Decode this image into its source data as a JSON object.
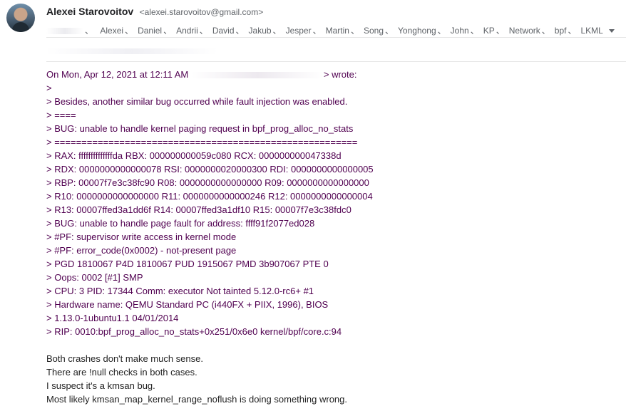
{
  "sender": {
    "name": "Alexei Starovoitov",
    "email": "<alexei.starovoitov@gmail.com>"
  },
  "recipients": [
    "Alexei",
    "Daniel",
    "Andrii",
    "David",
    "Jakub",
    "Jesper",
    "Martin",
    "Song",
    "Yonghong",
    "John",
    "KP",
    "Network",
    "bpf",
    "LKML"
  ],
  "recipient_separator": "、",
  "quote": {
    "attribution_prefix": "On Mon, Apr 12, 2021 at 12:11 AM",
    "attribution_suffix": "> wrote:",
    "lines": [
      ">",
      "> Besides, another similar bug occurred while fault injection was enabled.",
      "> ====",
      "> BUG: unable to handle kernel paging request in bpf_prog_alloc_no_stats",
      "> ========================================================",
      "> RAX: ffffffffffffffda RBX: 000000000059c080 RCX: 000000000047338d",
      "> RDX: 0000000000000078 RSI: 0000000020000300 RDI: 0000000000000005",
      "> RBP: 00007f7e3c38fc90 R08: 0000000000000000 R09: 0000000000000000",
      "> R10: 0000000000000000 R11: 0000000000000246 R12: 0000000000000004",
      "> R13: 00007ffed3a1dd6f R14: 00007ffed3a1df10 R15: 00007f7e3c38fdc0",
      "> BUG: unable to handle page fault for address: ffff91f2077ed028",
      "> #PF: supervisor write access in kernel mode",
      "> #PF: error_code(0x0002) - not-present page",
      "> PGD 1810067 P4D 1810067 PUD 1915067 PMD 3b907067 PTE 0",
      "> Oops: 0002 [#1] SMP",
      "> CPU: 3 PID: 17344 Comm: executor Not tainted 5.12.0-rc6+ #1",
      "> Hardware name: QEMU Standard PC (i440FX + PIIX, 1996), BIOS",
      "> 1.13.0-1ubuntu1.1 04/01/2014",
      "> RIP: 0010:bpf_prog_alloc_no_stats+0x251/0x6e0 kernel/bpf/core.c:94"
    ]
  },
  "reply_lines": [
    "Both crashes don't make much sense.",
    "There are !null checks in both cases.",
    "I suspect it's a kmsan bug.",
    "Most likely kmsan_map_kernel_range_noflush is doing something wrong."
  ],
  "colors": {
    "quote_text": "#500050",
    "body_text": "#222222",
    "meta_text": "#5f6368"
  },
  "icons": {
    "recipients_expand": "chevron-down-icon"
  }
}
